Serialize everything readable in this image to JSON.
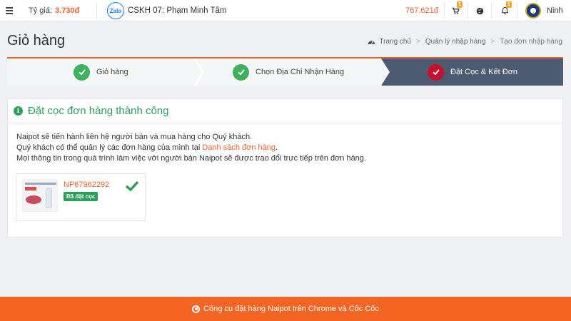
{
  "topbar": {
    "rate_label": "Tỷ giá:",
    "rate_value": "3.730đ",
    "zalo_logo": "Zalo",
    "support": "CSKH 07: Phạm Minh Tâm",
    "balance": "767.621đ",
    "cart_badge": "1",
    "bell_badge": "1",
    "user_name": "Ninh"
  },
  "page": {
    "title": "Giỏ hàng",
    "breadcrumb": [
      "Trang chủ",
      "Quản lý nhập hàng",
      "Tạo đơn nhập hàng"
    ]
  },
  "steps": [
    {
      "label": "Giỏ hàng",
      "state": "done"
    },
    {
      "label": "Chọn Địa Chỉ Nhận Hàng",
      "state": "done"
    },
    {
      "label": "Đặt Cọc & Kết Đơn",
      "state": "active"
    }
  ],
  "card": {
    "title": "Đặt cọc đơn hàng thành công",
    "line1": "Naipot sẽ tiến hành liên hệ người bán và mua hàng cho Quý khách.",
    "line2_prefix": "Quý khách có thể quản lý các đơn hàng của mình tại ",
    "line2_link": "Danh sách đơn hàng",
    "line2_suffix": ".",
    "line3": "Mọi thông tin trong quá trình làm việc với người bán Naipot sẽ được trao đổi trực tiếp trên đơn hàng."
  },
  "order": {
    "code": "NP67962292",
    "status": "Đã đặt cọc"
  },
  "footer": {
    "text": "Công cụ đặt hàng Naipot trên Chrome và Cốc Cốc"
  },
  "colors": {
    "accent": "#f26522",
    "success": "#2aa05a",
    "active_step": "#4d5b70",
    "active_circle": "#c8102e"
  }
}
